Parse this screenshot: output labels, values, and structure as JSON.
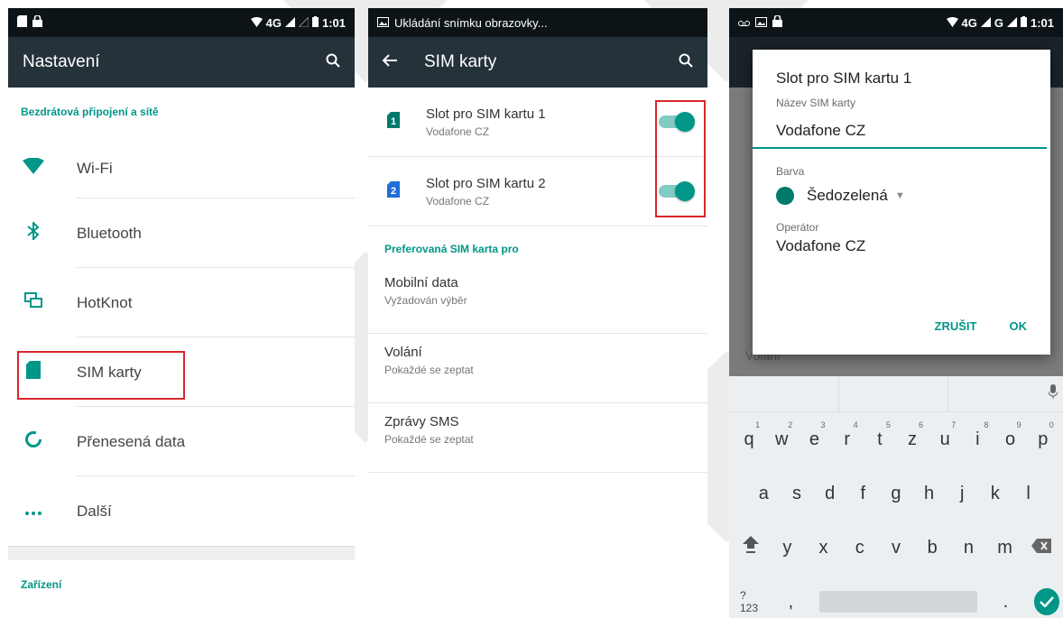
{
  "screen1": {
    "status_time": "1:01",
    "status_net": "4G",
    "title": "Nastavení",
    "section_wireless": "Bezdrátová připojení a sítě",
    "items": [
      {
        "label": "Wi-Fi",
        "icon": "wifi-icon"
      },
      {
        "label": "Bluetooth",
        "icon": "bluetooth-icon"
      },
      {
        "label": "HotKnot",
        "icon": "hotknot-icon"
      },
      {
        "label": "SIM karty",
        "icon": "sim-card-icon"
      },
      {
        "label": "Přenesená data",
        "icon": "data-usage-icon"
      },
      {
        "label": "Další",
        "icon": "more-icon"
      }
    ],
    "section_device": "Zařízení"
  },
  "screen2": {
    "notification": "Ukládání snímku obrazovky...",
    "title": "SIM karty",
    "sims": [
      {
        "badge": "1",
        "title": "Slot pro SIM kartu 1",
        "subtitle": "Vodafone CZ",
        "enabled": true
      },
      {
        "badge": "2",
        "title": "Slot pro SIM kartu 2",
        "subtitle": "Vodafone CZ",
        "enabled": true
      }
    ],
    "section_preferred": "Preferovaná SIM karta pro",
    "prefs": [
      {
        "title": "Mobilní data",
        "subtitle": "Vyžadován výběr"
      },
      {
        "title": "Volání",
        "subtitle": "Pokaždé se zeptat"
      },
      {
        "title": "Zprávy SMS",
        "subtitle": "Pokaždé se zeptat"
      }
    ]
  },
  "screen3": {
    "status_time": "1:01",
    "status_net": "4G",
    "status_net2": "G",
    "dialog": {
      "title": "Slot pro SIM kartu 1",
      "name_label": "Název SIM karty",
      "name_value": "Vodafone CZ",
      "color_label": "Barva",
      "color_value": "Šedozelená",
      "operator_label": "Operátor",
      "operator_value": "Vodafone CZ",
      "cancel": "ZRUŠIT",
      "ok": "OK"
    },
    "behind_text": "Volání",
    "keyboard": {
      "row1": [
        "q",
        "w",
        "e",
        "r",
        "t",
        "z",
        "u",
        "i",
        "o",
        "p"
      ],
      "row1_hints": [
        "1",
        "2",
        "3",
        "4",
        "5",
        "6",
        "7",
        "8",
        "9",
        "0"
      ],
      "row2": [
        "a",
        "s",
        "d",
        "f",
        "g",
        "h",
        "j",
        "k",
        "l"
      ],
      "row3": [
        "y",
        "x",
        "c",
        "v",
        "b",
        "n",
        "m"
      ],
      "sym_label": "?123",
      "comma": ",",
      "period": "."
    }
  },
  "colors": {
    "accent": "#009688",
    "appbar": "#26323a",
    "statusbar": "#0d1418",
    "highlight_box": "#d9262c"
  }
}
